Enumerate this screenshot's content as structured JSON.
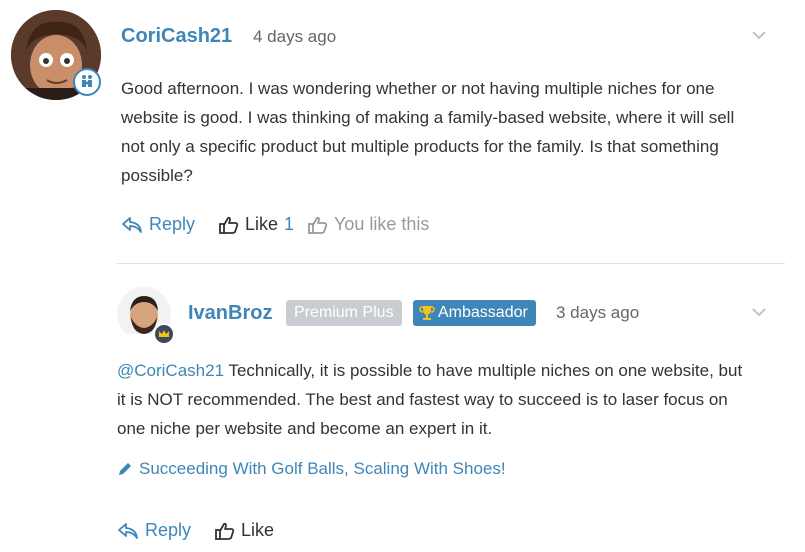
{
  "comment": {
    "author": "CoriCash21",
    "time": "4 days ago",
    "body_lines": [
      "Good afternoon. I was wondering whether or not having multiple niches for one",
      "website is good. I was thinking of making a family-based website, where it will sell",
      "not only a specific product but multiple products for the family. Is that something",
      "possible?"
    ],
    "reply_label": "Reply",
    "like_label": "Like",
    "like_count": "1",
    "you_like_label": "You like this"
  },
  "reply": {
    "author": "IvanBroz",
    "badges": {
      "premium": "Premium Plus",
      "ambassador": "Ambassador"
    },
    "time": "3 days ago",
    "mention": "@CoriCash21",
    "body_first": " Technically, it is possible to have multiple niches on one website, but",
    "body_lines": [
      "it is NOT recommended. The best and fastest way to succeed is to laser focus on",
      "one niche per website and become an expert in it."
    ],
    "signature": "Succeeding With Golf Balls, Scaling With Shoes!",
    "reply_label": "Reply",
    "like_label": "Like"
  },
  "colors": {
    "link": "#3f86b8",
    "premium_badge": "#c9cdd1",
    "ambassador_badge": "#3f86b8"
  }
}
